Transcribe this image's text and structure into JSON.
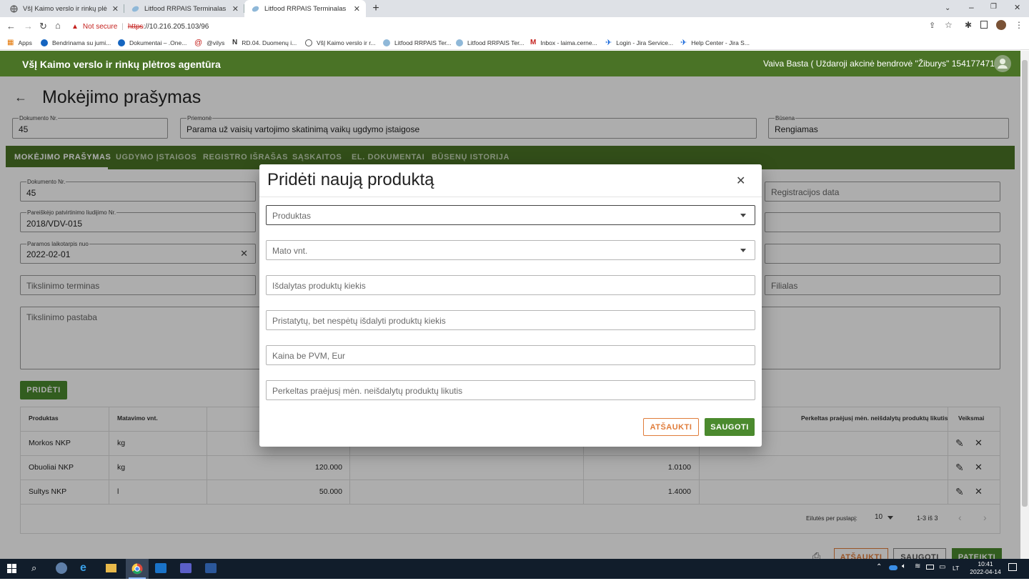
{
  "browser": {
    "tabs": [
      {
        "title": "VšĮ Kaimo verslo ir rinkų plėtros a",
        "active": false
      },
      {
        "title": "Litfood RRPAIS Terminalas",
        "active": false
      },
      {
        "title": "Litfood RRPAIS Terminalas",
        "active": true
      }
    ],
    "new_tab": "+",
    "security": "Not secure",
    "url_scheme": "https",
    "url_rest": "://10.216.205.103/96",
    "bookmarks": [
      {
        "label": "Apps"
      },
      {
        "label": "Bendrinama su jumi..."
      },
      {
        "label": "Dokumentai – .One..."
      },
      {
        "label": "@vilys"
      },
      {
        "label": "RD.04. Duomenų i..."
      },
      {
        "label": "VšĮ Kaimo verslo ir r..."
      },
      {
        "label": "Litfood RRPAIS Ter..."
      },
      {
        "label": "Litfood RRPAIS Ter..."
      },
      {
        "label": "Inbox - laima.cerne..."
      },
      {
        "label": "Login - Jira Service..."
      },
      {
        "label": "Help Center - Jira S..."
      }
    ]
  },
  "app": {
    "org_title": "VšĮ Kaimo verslo ir rinkų plėtros agentūra",
    "user": "Vaiva Basta ( Uždaroji akcinė bendrovė \"Žiburys\" 154177471 )"
  },
  "page": {
    "title": "Mokėjimo prašymas",
    "doc_no_label": "Dokumento Nr.",
    "doc_no": "45",
    "measure_label": "Priemonė",
    "measure": "Parama už vaisių vartojimo skatinimą vaikų ugdymo įstaigose",
    "status_label": "Būsena",
    "status": "Rengiamas",
    "tabs": [
      "MOKĖJIMO PRAŠYMAS",
      "UGDYMO ĮSTAIGOS",
      "REGISTRO IŠRAŠAS",
      "SĄSKAITOS",
      "EL. DOKUMENTAI",
      "BŪSENŲ ISTORIJA"
    ],
    "form": {
      "doc_no_label": "Dokumento Nr.",
      "doc_no": "45",
      "cert_label": "Pareiškėjo patvirtinimo liudijimo Nr.",
      "cert": "2018/VDV-015",
      "period_label": "Paramos laikotarpis nuo",
      "period": "2022-02-01",
      "deadline_ph": "Tikslinimo terminas",
      "note_ph": "Tikslinimo pastaba",
      "reg_date_ph": "Registracijos data",
      "branch_ph": "Filialas"
    },
    "add_button": "PRIDĖTI",
    "table": {
      "headers": [
        "Produktas",
        "Matavimo vnt.",
        "Perkeltas praėjusį mėn. neišdalytų produktų likutis",
        "Veiksmai"
      ],
      "rows": [
        {
          "product": "Morkos NKP",
          "unit": "kg",
          "qty": "",
          "price": ""
        },
        {
          "product": "Obuoliai NKP",
          "unit": "kg",
          "qty": "120.000",
          "price": "1.0100"
        },
        {
          "product": "Sultys NKP",
          "unit": "l",
          "qty": "50.000",
          "price": "1.4000"
        }
      ],
      "rows_per_page_label": "Eilutės per puslapį:",
      "rows_per_page": "10",
      "range": "1-3 iš 3"
    },
    "footer_buttons": [
      "ATŠAUKTI",
      "SAUGOTI",
      "PATEIKTI"
    ]
  },
  "dialog": {
    "title": "Pridėti naują produktą",
    "fields": {
      "product": "Produktas",
      "unit": "Mato vnt.",
      "distributed": "Išdalytas produktų kiekis",
      "delivered": "Pristatytų, bet nespėtų išdalyti produktų kiekis",
      "price": "Kaina be PVM, Eur",
      "carried": "Perkeltas praėjusį mėn. neišdalytų produktų likutis"
    },
    "cancel": "ATŠAUKTI",
    "save": "SAUGOTI"
  },
  "taskbar": {
    "lang": "LT",
    "time": "10:41",
    "date": "2022-04-14"
  },
  "colors": {
    "brand_green": "#4a7326",
    "save_green": "#4b8a2e",
    "cancel_orange": "#e07c3a"
  }
}
